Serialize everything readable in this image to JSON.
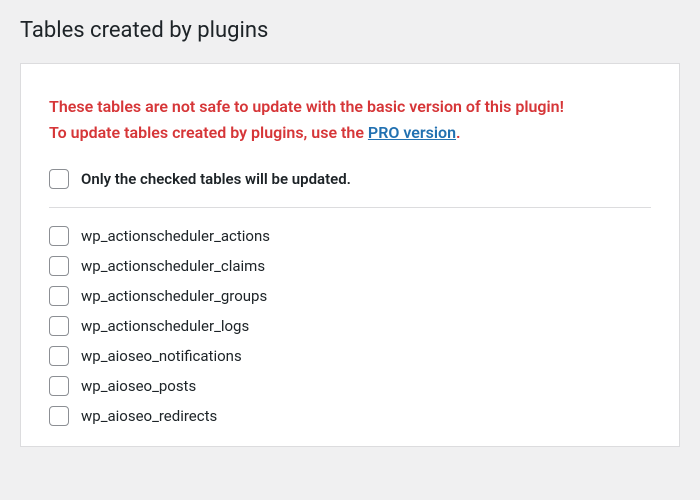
{
  "title": "Tables created by plugins",
  "warning": {
    "line1": "These tables are not safe to update with the basic version of this plugin!",
    "line2_prefix": "To update tables created by plugins, use the ",
    "link_text": "PRO version",
    "line2_suffix": "."
  },
  "master_label": "Only the checked tables will be updated.",
  "tables": [
    "wp_actionscheduler_actions",
    "wp_actionscheduler_claims",
    "wp_actionscheduler_groups",
    "wp_actionscheduler_logs",
    "wp_aioseo_notifications",
    "wp_aioseo_posts",
    "wp_aioseo_redirects"
  ]
}
